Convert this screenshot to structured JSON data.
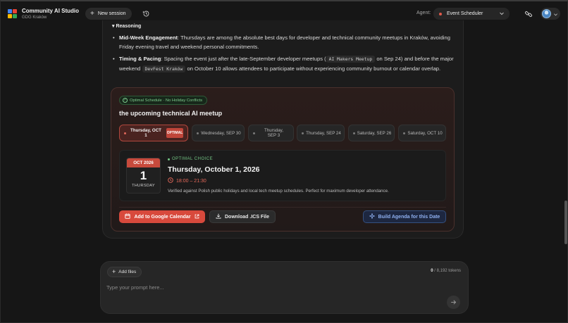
{
  "header": {
    "app_title": "Community AI Studio",
    "app_subtitle": "GDG Kraków",
    "new_session_label": "New session",
    "agent_label": "Agent:",
    "agent_value": "Event Scheduler",
    "logo_colors": [
      "#4285F4",
      "#EA4335",
      "#FBBC05",
      "#34A853"
    ]
  },
  "reasoning": {
    "heading": "▾ Reasoning",
    "bullets": [
      {
        "title": "Mid-Week Engagement",
        "text": ": Thursdays are among the absolute best days for developer and technical community meetups in Kraków, avoiding Friday evening travel and weekend personal commitments."
      },
      {
        "title": "Timing & Pacing",
        "text_a": ": Spacing the event just after the late-September developer meetups (",
        "code_a": "AI Makers Meetup",
        "text_b": " on Sep 24) and before the major weekend ",
        "code_b": "DevFest Kraków",
        "text_c": " on October 10 allows attendees to participate without experiencing community burnout or calendar overlap."
      }
    ]
  },
  "schedule": {
    "badge": "Optimal Schedule · No Holiday Conflicts",
    "title": "the upcoming technical AI meetup",
    "options": [
      {
        "label": "Thursday, OCT 1",
        "tag": "OPTIMAL",
        "selected": true
      },
      {
        "label": "Wednesday, SEP 30"
      },
      {
        "label": "Thursday, SEP 3"
      },
      {
        "label": "Thursday, SEP 24"
      },
      {
        "label": "Saturday, SEP 26"
      },
      {
        "label": "Saturday, OCT 10"
      }
    ],
    "detail": {
      "cal_month": "OCT 2026",
      "cal_day": "1",
      "cal_weekday": "THURSDAY",
      "choice_label": "OPTIMAL CHOICE",
      "date_title": "Thursday, October 1, 2026",
      "time": "18:00 – 21:30",
      "note": "Verified against Polish public holidays and local tech meetup schedules. Perfect for maximum developer attendance."
    },
    "actions": {
      "google_calendar": "Add to Google Calendar",
      "download_ics": "Download .ICS File",
      "build_agenda": "Build Agenda for this Date"
    }
  },
  "composer": {
    "add_files_label": "Add files",
    "tokens_used": "0",
    "tokens_total": " / 8,192 tokens",
    "placeholder": "Type your prompt here..."
  },
  "colors": {
    "accent_red": "#d8493c",
    "success_green": "#74c785",
    "agenda_blue": "#8fb0f0"
  }
}
